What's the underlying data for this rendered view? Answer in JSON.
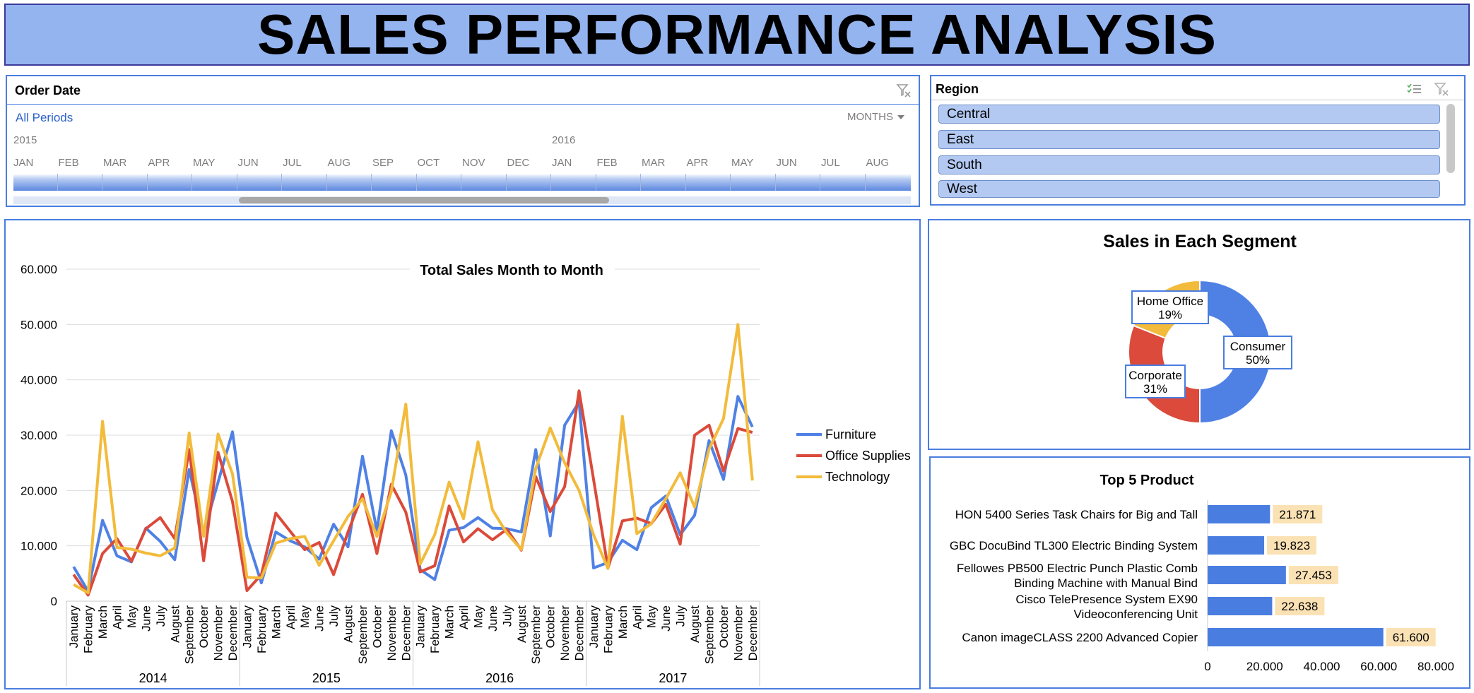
{
  "title": "SALES PERFORMANCE ANALYSIS",
  "timeline": {
    "title": "Order Date",
    "all_periods": "All Periods",
    "level": "MONTHS",
    "years": [
      "2015",
      "2016"
    ],
    "months": [
      "JAN",
      "FEB",
      "MAR",
      "APR",
      "MAY",
      "JUN",
      "JUL",
      "AUG",
      "SEP",
      "OCT",
      "NOV",
      "DEC",
      "JAN",
      "FEB",
      "MAR",
      "APR",
      "MAY",
      "JUN",
      "JUL",
      "AUG"
    ]
  },
  "region": {
    "title": "Region",
    "items": [
      "Central",
      "East",
      "South",
      "West"
    ]
  },
  "colors": {
    "furniture": "#4f81e5",
    "office_supplies": "#db4a3a",
    "technology": "#f2bb3b",
    "bar": "#4a7de0",
    "label_bg": "#fbe2b5",
    "panel_border": "#4a7de0",
    "banner": "#94b4f0"
  },
  "chart_data": [
    {
      "type": "line",
      "title": "Total Sales Month to Month",
      "xlabel": "",
      "ylabel": "",
      "years": [
        "2014",
        "2015",
        "2016",
        "2017"
      ],
      "categories": [
        "January",
        "February",
        "March",
        "April",
        "May",
        "June",
        "July",
        "August",
        "September",
        "October",
        "November",
        "December"
      ],
      "ylim": [
        0,
        60000
      ],
      "y_ticks": [
        "0",
        "10.000",
        "20.000",
        "30.000",
        "40.000",
        "50.000",
        "60.000"
      ],
      "grid": true,
      "legend_position": "right",
      "series": [
        {
          "name": "Furniture",
          "values": [
            6200,
            1800,
            14600,
            8200,
            7100,
            13200,
            10800,
            7500,
            23800,
            12300,
            21500,
            30600,
            11500,
            3300,
            12500,
            10900,
            9800,
            7600,
            13900,
            9800,
            26200,
            12700,
            30800,
            22800,
            5700,
            3900,
            12800,
            13300,
            15100,
            13200,
            13100,
            12500,
            27400,
            11800,
            31800,
            36000,
            6000,
            7000,
            11000,
            9300,
            16900,
            19000,
            12000,
            15500,
            29000,
            22000,
            37000,
            31500
          ]
        },
        {
          "name": "Office Supplies",
          "values": [
            4800,
            1100,
            8600,
            11300,
            7200,
            13100,
            15100,
            11300,
            27400,
            7300,
            26900,
            18000,
            1900,
            4800,
            15900,
            12600,
            9300,
            10600,
            4800,
            12500,
            19300,
            8600,
            21100,
            16100,
            5300,
            6400,
            17200,
            10700,
            13100,
            11100,
            13000,
            9200,
            22500,
            16200,
            20700,
            38000,
            22000,
            6000,
            14500,
            15000,
            14000,
            17500,
            10300,
            30000,
            31800,
            23500,
            31200,
            30500
          ]
        },
        {
          "name": "Technology",
          "values": [
            3000,
            1500,
            32500,
            9700,
            9400,
            8700,
            8200,
            9600,
            30400,
            11700,
            30200,
            23000,
            4300,
            4200,
            10500,
            11300,
            11700,
            6500,
            10900,
            15300,
            18500,
            11700,
            19800,
            35600,
            6700,
            12000,
            21500,
            14900,
            28800,
            16500,
            12300,
            9300,
            24000,
            31300,
            25000,
            20000,
            12000,
            5900,
            33400,
            12200,
            14000,
            18500,
            23200,
            17000,
            27500,
            33000,
            50000,
            21800
          ]
        }
      ]
    },
    {
      "type": "pie",
      "title": "Sales in Each Segment",
      "categories": [
        "Consumer",
        "Corporate",
        "Home Office"
      ],
      "values": [
        50,
        31,
        19
      ],
      "labels": [
        "50%",
        "31%",
        "19%"
      ],
      "colors": [
        "#4f81e5",
        "#db4a3a",
        "#f2bb3b"
      ]
    },
    {
      "type": "bar",
      "orientation": "horizontal",
      "title": "Top 5 Product",
      "categories": [
        [
          "HON 5400 Series Task Chairs for Big and Tall"
        ],
        [
          "GBC DocuBind TL300 Electric Binding System"
        ],
        [
          "Fellowes PB500 Electric Punch Plastic Comb",
          "Binding Machine with Manual Bind"
        ],
        [
          "Cisco TelePresence System EX90",
          "Videoconferencing Unit"
        ],
        [
          "Canon imageCLASS 2200 Advanced Copier"
        ]
      ],
      "values": [
        21871,
        19823,
        27453,
        22638,
        61600
      ],
      "labels": [
        "21.871",
        "19.823",
        "27.453",
        "22.638",
        "61.600"
      ],
      "xlim": [
        0,
        80000
      ],
      "x_ticks": [
        "0",
        "20.000",
        "40.000",
        "60.000",
        "80.000"
      ]
    }
  ]
}
